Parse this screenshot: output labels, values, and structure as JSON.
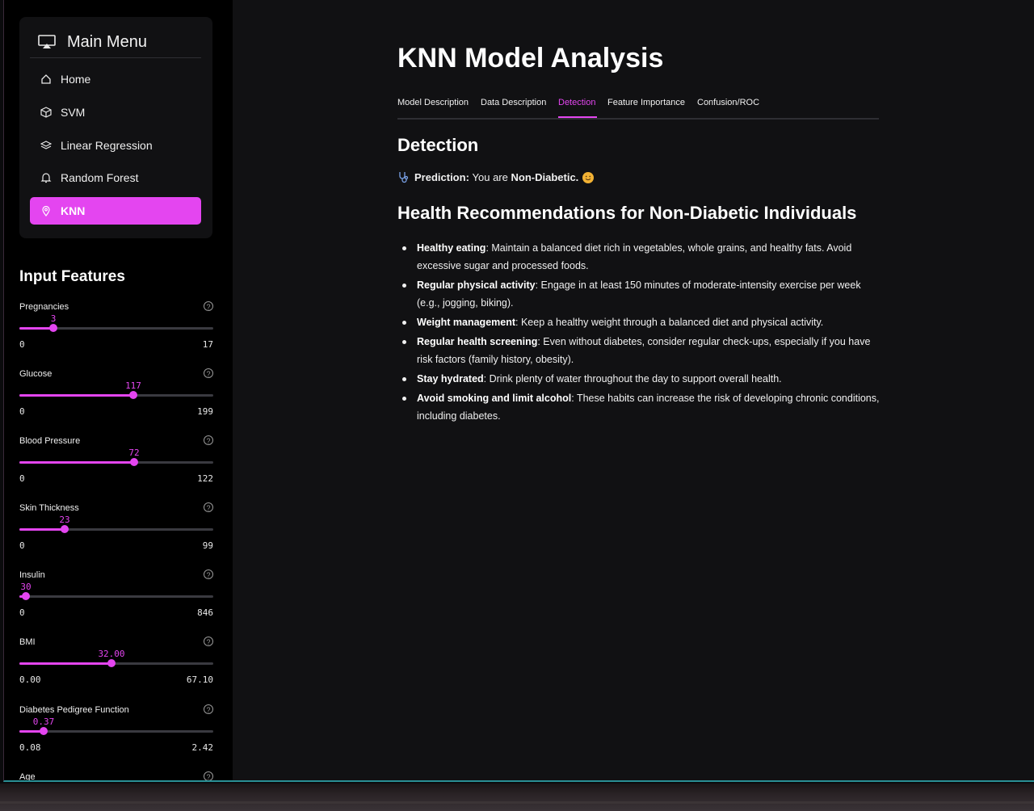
{
  "menu": {
    "title": "Main Menu",
    "items": [
      {
        "label": "Home",
        "icon": "house-icon"
      },
      {
        "label": "SVM",
        "icon": "box-icon"
      },
      {
        "label": "Linear Regression",
        "icon": "layers-icon"
      },
      {
        "label": "Random Forest",
        "icon": "bell-icon"
      },
      {
        "label": "KNN",
        "icon": "map-pin-icon",
        "active": true
      }
    ]
  },
  "input_features": {
    "title": "Input Features",
    "features": [
      {
        "label": "Pregnancies",
        "value": "3",
        "min": "0",
        "max": "17",
        "level": 0.176
      },
      {
        "label": "Glucose",
        "value": "117",
        "min": "0",
        "max": "199",
        "level": 0.588
      },
      {
        "label": "Blood Pressure",
        "value": "72",
        "min": "0",
        "max": "122",
        "level": 0.59
      },
      {
        "label": "Skin Thickness",
        "value": "23",
        "min": "0",
        "max": "99",
        "level": 0.232
      },
      {
        "label": "Insulin",
        "value": "30",
        "min": "0",
        "max": "846",
        "level": 0.035
      },
      {
        "label": "BMI",
        "value": "32.00",
        "min": "0.00",
        "max": "67.10",
        "level": 0.477
      },
      {
        "label": "Diabetes Pedigree Function",
        "value": "0.37",
        "min": "0.08",
        "max": "2.42",
        "level": 0.124
      },
      {
        "label": "Age"
      }
    ]
  },
  "main": {
    "title": "KNN Model Analysis",
    "tabs": [
      "Model Description",
      "Data Description",
      "Detection",
      "Feature Importance",
      "Confusion/ROC"
    ],
    "active_tab": "Detection",
    "section_title": "Detection",
    "prediction": {
      "label": "Prediction:",
      "text": "You are",
      "result": "Non-Diabetic."
    },
    "recommendations_title": "Health Recommendations for Non-Diabetic Individuals",
    "recommendations": [
      {
        "bold": "Healthy eating",
        "text": ": Maintain a balanced diet rich in vegetables, whole grains, and healthy fats. Avoid excessive sugar and processed foods."
      },
      {
        "bold": "Regular physical activity",
        "text": ": Engage in at least 150 minutes of moderate-intensity exercise per week (e.g., jogging, biking)."
      },
      {
        "bold": "Weight management",
        "text": ": Keep a healthy weight through a balanced diet and physical activity."
      },
      {
        "bold": "Regular health screening",
        "text": ": Even without diabetes, consider regular check-ups, especially if you have risk factors (family history, obesity)."
      },
      {
        "bold": "Stay hydrated",
        "text": ": Drink plenty of water throughout the day to support overall health."
      },
      {
        "bold": "Avoid smoking and limit alcohol",
        "text": ": These habits can increase the risk of developing chronic conditions, including diabetes."
      }
    ]
  },
  "colors": {
    "accent": "#e445f0",
    "background": "#111113",
    "sidebar": "#000000"
  }
}
